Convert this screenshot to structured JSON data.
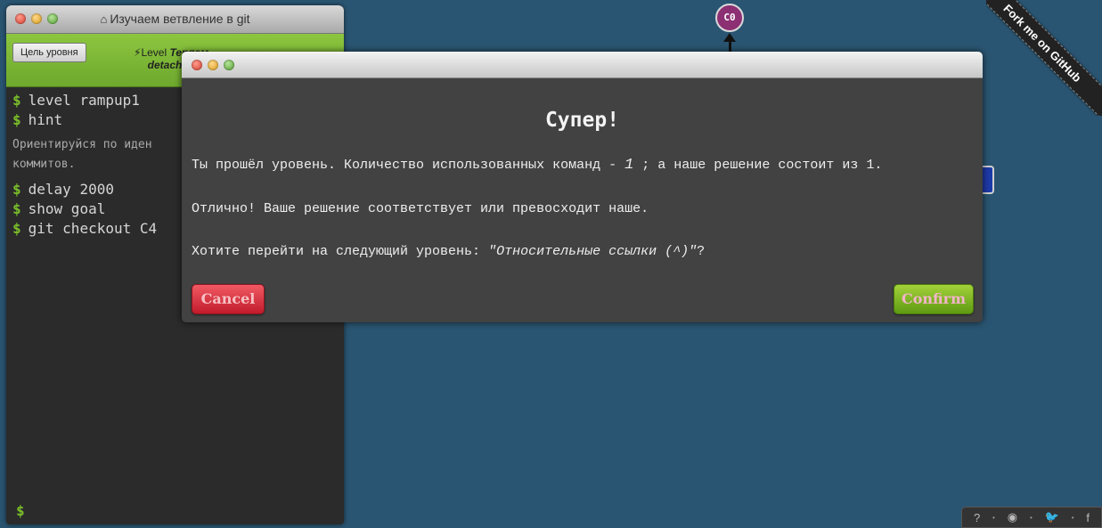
{
  "terminal": {
    "title": "Изучаем ветвление в git",
    "goal_button": "Цель уровня",
    "level_prefix": "Level",
    "level_name_part1": "Теряем",
    "level_name_part2": "detached",
    "commands": [
      {
        "text": "level rampup1"
      },
      {
        "text": "hint"
      }
    ],
    "hint_text": "Ориентируйся по иден\nкоммитов.",
    "commands2": [
      {
        "text": "delay 2000"
      },
      {
        "text": "show goal"
      },
      {
        "text": "git checkout C4"
      }
    ],
    "prompt_symbol": "$"
  },
  "tree": {
    "commit_label": "C0",
    "ribbon_text": "Fork me on GitHub"
  },
  "footer": {
    "icons": [
      "help-icon",
      "globe-icon",
      "twitter-icon",
      "facebook-icon"
    ],
    "glyphs": [
      "?",
      "◉",
      "🐦",
      "f"
    ]
  },
  "modal": {
    "heading": "Супер!",
    "line1_before": "Ты прошёл уровень. Количество использованных команд - ",
    "line1_count": "1",
    "line1_after": " ; а наше решение состоит из 1.",
    "line2": "Отлично! Ваше решение соответствует или превосходит наше.",
    "line3_before": "Хотите перейти на следующий уровень: ",
    "line3_level": "\"Относительные ссылки (^)\"",
    "line3_after": "?",
    "cancel_label": "Cancel",
    "confirm_label": "Confirm"
  },
  "colors": {
    "background": "#2a5572",
    "toolbar_green": "#7bb533",
    "commit_node": "#8c2f73",
    "cancel_red": "#d9303e",
    "confirm_green": "#7fb626"
  }
}
